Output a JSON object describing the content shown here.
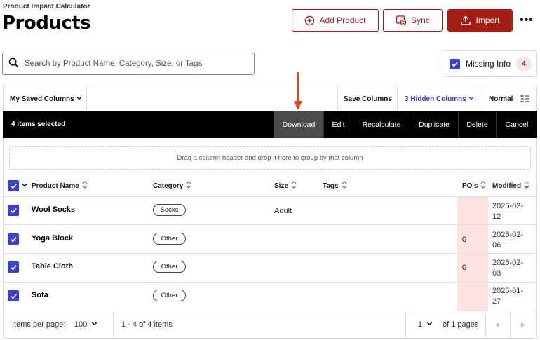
{
  "header": {
    "app_name": "Product Impact Calculator",
    "title": "Products",
    "add_label": "Add Product",
    "sync_label": "Sync",
    "import_label": "Import",
    "more_label": "•••"
  },
  "search": {
    "placeholder": "Search by Product Name, Category, Size, or Tags"
  },
  "missing_info": {
    "label": "Missing Info",
    "count": "4",
    "checked": true
  },
  "toolbar": {
    "saved_columns": "My Saved Columns",
    "save_columns": "Save Columns",
    "hidden_columns": "3 Hidden Columns",
    "density": "Normal"
  },
  "selection": {
    "count_label": "4 items selected",
    "actions": [
      "Download",
      "Edit",
      "Recalculate",
      "Duplicate",
      "Delete",
      "Cancel"
    ],
    "active_action": "Download"
  },
  "group_zone": "Drag a column header and drop it here to group by that column",
  "columns": [
    "Product Name",
    "Category",
    "Size",
    "Tags",
    "PO's",
    "Modified"
  ],
  "rows": [
    {
      "name": "Wool Socks",
      "category": "Socks",
      "size": "Adult",
      "tags": "",
      "po": "",
      "modified_1": "2025-02-",
      "modified_2": "12"
    },
    {
      "name": "Yoga Block",
      "category": "Other",
      "size": "",
      "tags": "",
      "po": "0",
      "modified_1": "2025-02-",
      "modified_2": "06"
    },
    {
      "name": "Table Cloth",
      "category": "Other",
      "size": "",
      "tags": "",
      "po": "0",
      "modified_1": "2025-02-",
      "modified_2": "03"
    },
    {
      "name": "Sofa",
      "category": "Other",
      "size": "",
      "tags": "",
      "po": "",
      "modified_1": "2025-01-",
      "modified_2": "27"
    }
  ],
  "footer": {
    "items_per_page_label": "Items per page:",
    "items_per_page_value": "100",
    "range_label": "1 - 4 of 4 items",
    "page_value": "1",
    "pages_label": "of 1 pages"
  },
  "colors": {
    "accent": "#a31d14",
    "checkbox": "#3b3fd6",
    "highlight": "#fde2e2",
    "arrow": "#e8401c"
  }
}
